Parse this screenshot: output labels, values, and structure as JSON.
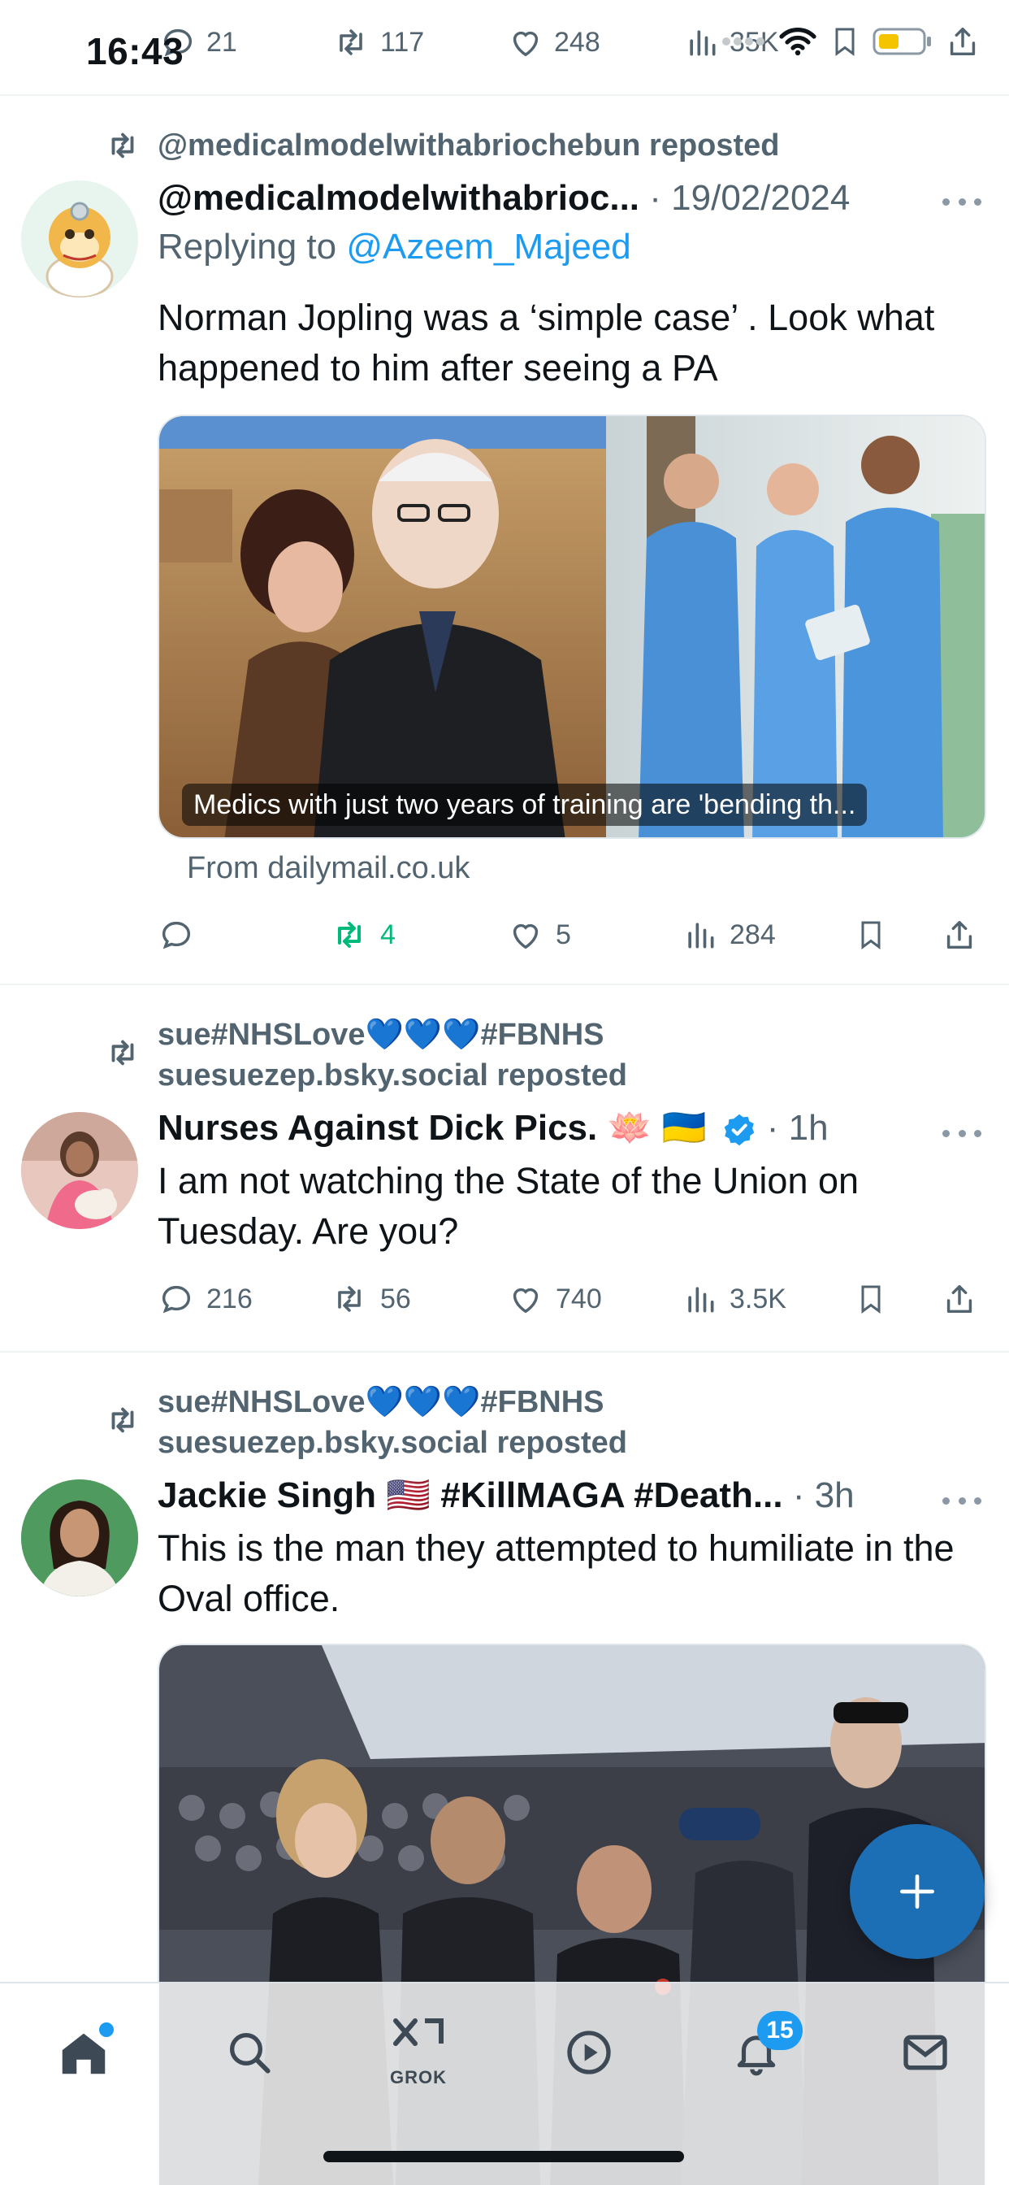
{
  "status_bar": {
    "time": "16:43"
  },
  "header_actions": {
    "replies": "21",
    "reposts": "117",
    "likes": "248",
    "views": "35K"
  },
  "tweets": [
    {
      "reposted_by": "@medicalmodelwithabriochebun reposted",
      "author": "@medicalmodelwithabrioc...",
      "date": "· 19/02/2024",
      "replying_prefix": "Replying to ",
      "replying_to": "@Azeem_Majeed",
      "text": "Norman Jopling was a ‘simple case’ . Look what happened to him after seeing a PA",
      "media_caption": "Medics with just two years of training are 'bending th...",
      "link_source": "From dailymail.co.uk",
      "replies": "",
      "reposts": "4",
      "likes": "5",
      "views": "284"
    },
    {
      "reposted_by_line1": "sue#NHSLove💙💙💙#FBNHS",
      "reposted_by_line2": "suesuezep.bsky.social reposted",
      "author": "Nurses Against Dick Pics. 🪷 🇺🇦",
      "time": "· 1h",
      "text": "I am not watching the State of the Union on Tuesday. Are you?",
      "replies": "216",
      "reposts": "56",
      "likes": "740",
      "views": "3.5K"
    },
    {
      "reposted_by_line1": "sue#NHSLove💙💙💙#FBNHS",
      "reposted_by_line2": "suesuezep.bsky.social reposted",
      "author": "Jackie Singh 🇺🇸 #KillMAGA #Death...",
      "time": "· 3h",
      "text": "This is the man they attempted to humiliate in the Oval office."
    }
  ],
  "bottom_nav": {
    "grok_label": "GROK",
    "notifications_badge": "15"
  },
  "colors": {
    "accent": "#1d9bf0",
    "repost_green": "#00ba7c",
    "muted": "#536471",
    "fab": "#1d6fb5"
  }
}
